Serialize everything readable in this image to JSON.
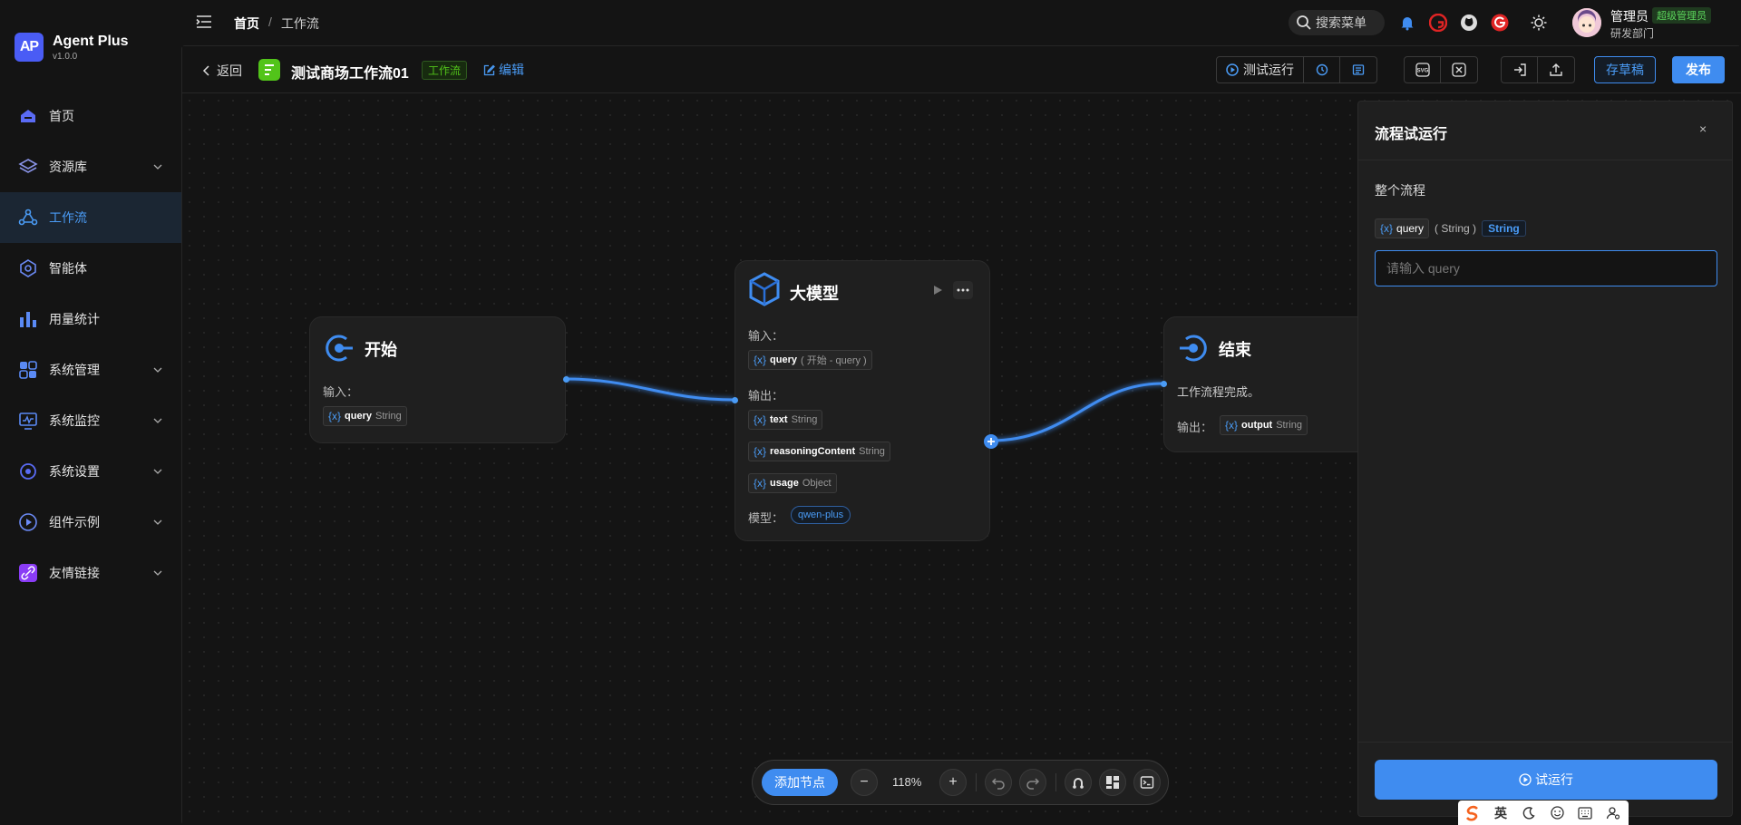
{
  "app": {
    "logo_mark": "AP",
    "name": "Agent Plus",
    "version": "v1.0.0"
  },
  "nav": [
    {
      "label": "首页",
      "icon": "home-icon",
      "chevron": false,
      "active": false
    },
    {
      "label": "资源库",
      "icon": "layers-icon",
      "chevron": true,
      "active": false
    },
    {
      "label": "工作流",
      "icon": "workflow-icon",
      "chevron": false,
      "active": true
    },
    {
      "label": "智能体",
      "icon": "agent-icon",
      "chevron": false,
      "active": false
    },
    {
      "label": "用量统计",
      "icon": "bar-chart-icon",
      "chevron": false,
      "active": false
    },
    {
      "label": "系统管理",
      "icon": "grid-icon",
      "chevron": true,
      "active": false
    },
    {
      "label": "系统监控",
      "icon": "monitor-icon",
      "chevron": true,
      "active": false
    },
    {
      "label": "系统设置",
      "icon": "settings-icon",
      "chevron": true,
      "active": false
    },
    {
      "label": "组件示例",
      "icon": "play-circle-icon",
      "chevron": true,
      "active": false
    },
    {
      "label": "友情链接",
      "icon": "link-icon",
      "chevron": true,
      "active": false
    }
  ],
  "header": {
    "breadcrumb_home": "首页",
    "breadcrumb_sep": "/",
    "breadcrumb_current": "工作流",
    "search_label": "搜索菜单",
    "user_name": "管理员",
    "user_role": "超级管理员",
    "user_dept": "研发部门"
  },
  "toolbar": {
    "back_label": "返回",
    "workflow_title": "测试商场工作流01",
    "workflow_tag": "工作流",
    "edit_label": "编辑",
    "test_run_label": "测试运行",
    "save_draft_label": "存草稿",
    "publish_label": "发布"
  },
  "nodes": {
    "start": {
      "title": "开始",
      "input_label": "输入：",
      "var_symbol": "{x}",
      "var_name": "query",
      "var_type": "String"
    },
    "llm": {
      "title": "大模型",
      "input_label": "输入：",
      "input_var": "query",
      "input_ref": "( 开始 - query )",
      "output_label": "输出：",
      "outputs": [
        {
          "name": "text",
          "type": "String"
        },
        {
          "name": "reasoningContent",
          "type": "String"
        },
        {
          "name": "usage",
          "type": "Object"
        }
      ],
      "model_label": "模型：",
      "model_name": "qwen-plus"
    },
    "end": {
      "title": "结束",
      "desc": "工作流程完成。",
      "output_label": "输出：",
      "var_name": "output",
      "var_type": "String"
    }
  },
  "bottom_bar": {
    "add_node_label": "添加节点",
    "zoom_out": "−",
    "zoom_level": "118%",
    "zoom_in": "+"
  },
  "run_panel": {
    "title": "流程试运行",
    "close": "×",
    "section_label": "整个流程",
    "param_symbol": "{x}",
    "param_name": "query",
    "param_type_text": "( String )",
    "param_type_badge": "String",
    "input_placeholder": "请输入 query",
    "run_label": "试运行"
  },
  "ime": {
    "lang": "英"
  },
  "colors": {
    "accent": "#3f8cf0",
    "success": "#52c41a",
    "background": "#141414",
    "node_bg": "#1f1f1f"
  }
}
